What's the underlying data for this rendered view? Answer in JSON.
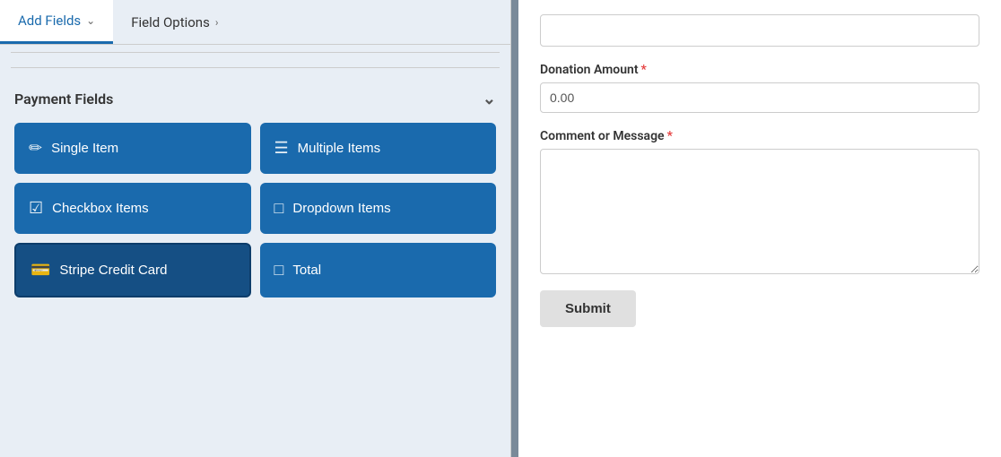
{
  "tabs": {
    "add_fields": {
      "label": "Add Fields",
      "active": true
    },
    "field_options": {
      "label": "Field Options"
    }
  },
  "payment_fields": {
    "section_label": "Payment Fields",
    "buttons": [
      {
        "id": "single-item",
        "label": "Single Item",
        "icon": "📄"
      },
      {
        "id": "multiple-items",
        "label": "Multiple Items",
        "icon": "≡"
      },
      {
        "id": "checkbox-items",
        "label": "Checkbox Items",
        "icon": "☑"
      },
      {
        "id": "dropdown-items",
        "label": "Dropdown Items",
        "icon": "⊟"
      },
      {
        "id": "stripe-credit-card",
        "label": "Stripe Credit Card",
        "icon": "💳",
        "hovered": true
      },
      {
        "id": "total",
        "label": "Total",
        "icon": "💰"
      }
    ]
  },
  "form": {
    "donation_amount": {
      "label": "Donation Amount",
      "required": true,
      "placeholder": "0.00"
    },
    "comment_or_message": {
      "label": "Comment or Message",
      "required": true,
      "placeholder": ""
    },
    "submit_button": "Submit"
  }
}
